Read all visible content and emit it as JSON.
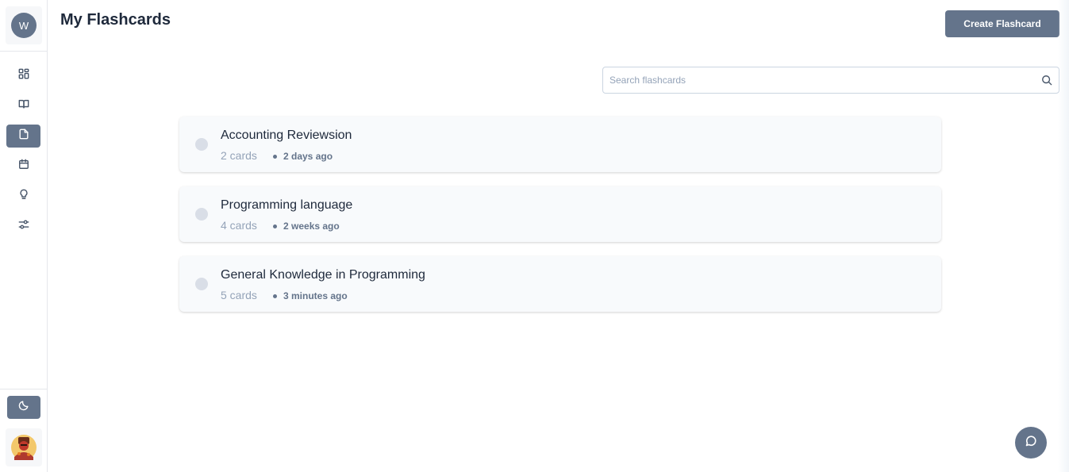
{
  "sidebar": {
    "avatar_initial": "W",
    "nav": [
      {
        "name": "dashboard",
        "icon": "grid-icon"
      },
      {
        "name": "library",
        "icon": "book-open-icon"
      },
      {
        "name": "flashcards",
        "icon": "file-icon",
        "active": true
      },
      {
        "name": "calendar",
        "icon": "calendar-icon"
      },
      {
        "name": "ideas",
        "icon": "lightbulb-icon"
      },
      {
        "name": "settings",
        "icon": "sliders-icon"
      }
    ],
    "theme_toggle_icon": "moon-icon",
    "user_photo_icon": "user-photo"
  },
  "header": {
    "title": "My Flashcards",
    "create_label": "Create Flashcard"
  },
  "search": {
    "placeholder": "Search flashcards",
    "value": ""
  },
  "flashcards": [
    {
      "title": "Accounting Reviewsion",
      "count": "2 cards",
      "time": "2 days ago"
    },
    {
      "title": "Programming language",
      "count": "4 cards",
      "time": "2 weeks ago"
    },
    {
      "title": "General Knowledge in Programming",
      "count": "5 cards",
      "time": "3 minutes ago"
    }
  ],
  "colors": {
    "accent": "#64748b",
    "text": "#1e293b",
    "muted": "#94a3b8",
    "card_bg": "#f8fafc"
  },
  "chat_icon": "message-circle-icon"
}
